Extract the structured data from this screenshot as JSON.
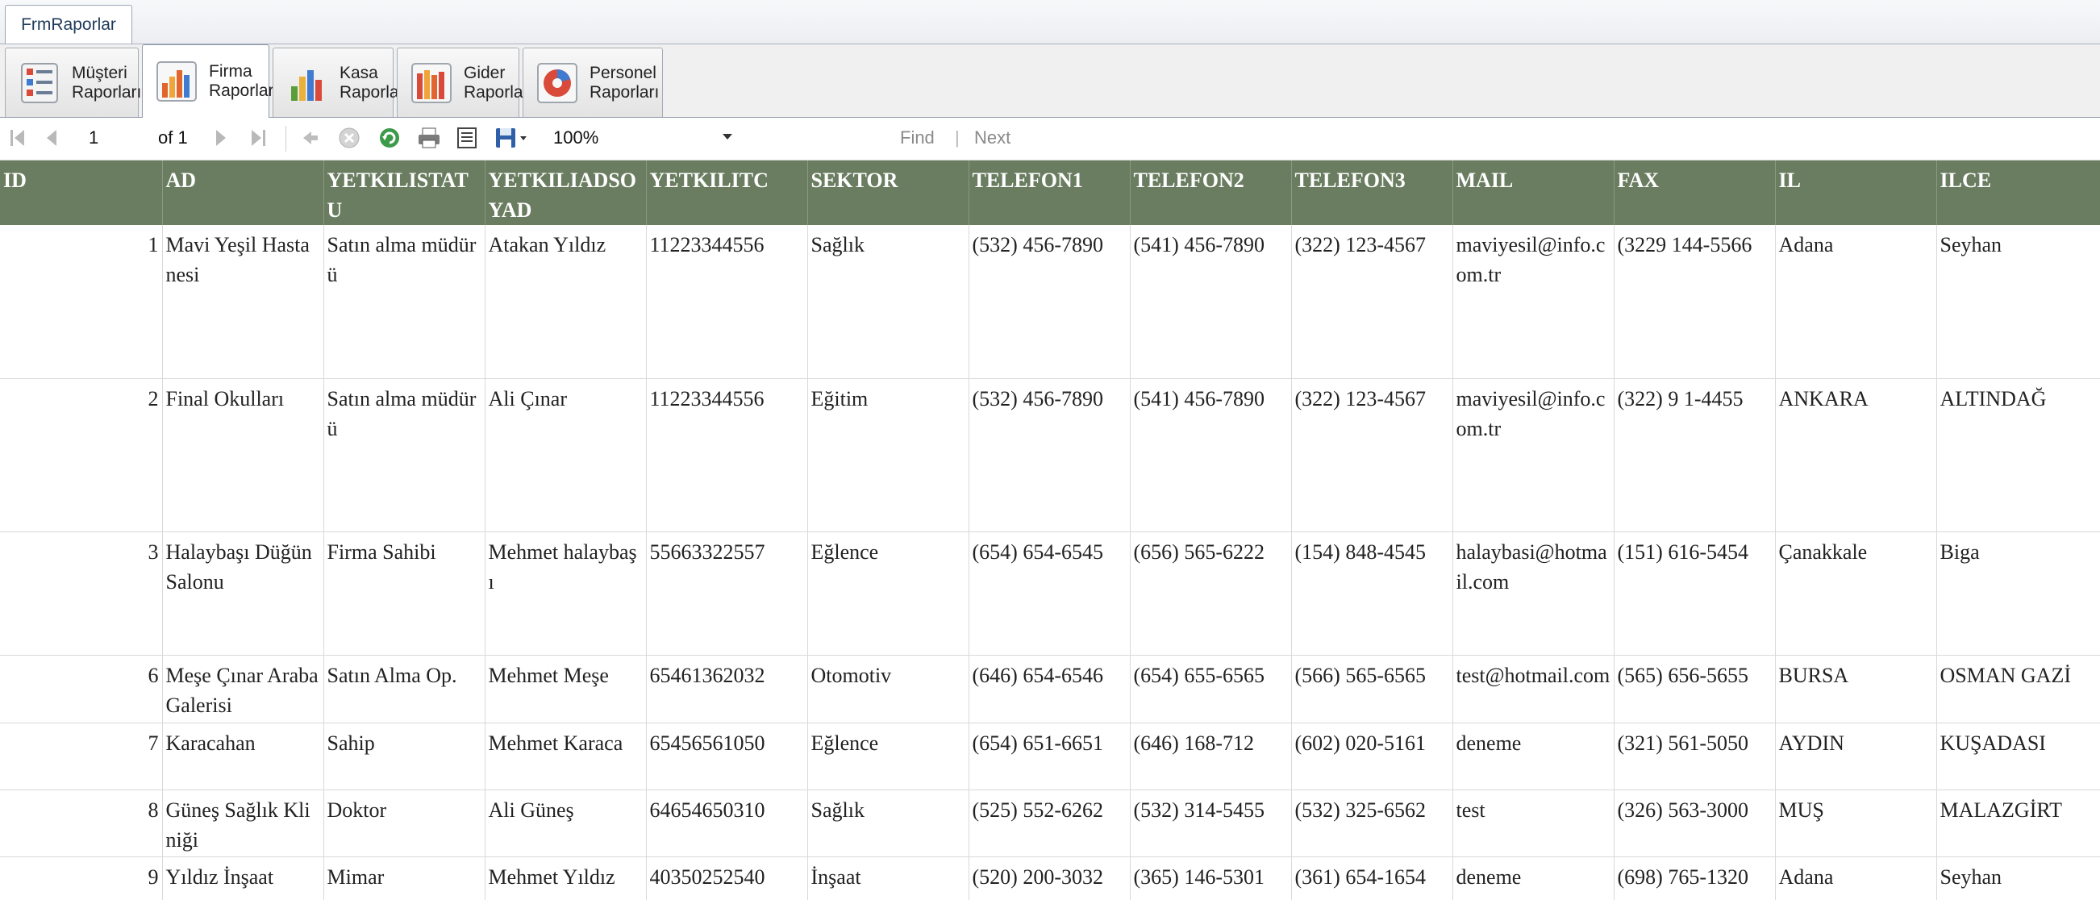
{
  "window": {
    "tab_title": "FrmRaporlar"
  },
  "report_tabs": [
    {
      "label": "Müşteri Raporları",
      "icon": "customer-report-icon"
    },
    {
      "label": "Firma Raporları",
      "icon": "bar-chart-icon"
    },
    {
      "label": "Kasa Raporları",
      "icon": "bar-chart-icon"
    },
    {
      "label": "Gider Raporları",
      "icon": "bar-chart-icon"
    },
    {
      "label": "Personel Raporları",
      "icon": "pie-chart-icon"
    }
  ],
  "active_tab": 1,
  "toolbar": {
    "page_value": "1",
    "of_label": "of 1",
    "zoom": "100%",
    "find_label": "Find",
    "separator": "|",
    "next_label": "Next"
  },
  "colors": {
    "header_bg": "#6a7d60",
    "header_text": "#ffffff"
  },
  "table": {
    "columns": [
      "ID",
      "AD",
      "YETKILISTATU",
      "YETKILIADSOYAD",
      "YETKILITC",
      "SEKTOR",
      "TELEFON1",
      "TELEFON2",
      "TELEFON3",
      "MAIL",
      "FAX",
      "IL",
      "ILCE"
    ],
    "rows": [
      [
        "1",
        "Mavi Yeşil Hastanesi",
        "Satın alma müdürü",
        "Atakan Yıldız",
        "11223344556",
        "Sağlık",
        "(532) 456-7890",
        "(541) 456-7890",
        "(322) 123-4567",
        "maviyesil@info.com.tr",
        "(3229 144-5566",
        "Adana",
        "Seyhan"
      ],
      [
        "2",
        "Final Okulları",
        "Satın alma müdürü",
        "Ali Çınar",
        "11223344556",
        "Eğitim",
        "(532) 456-7890",
        "(541) 456-7890",
        "(322) 123-4567",
        "maviyesil@info.com.tr",
        "(322) 9 1-4455",
        "ANKARA",
        "ALTINDAĞ"
      ],
      [
        "3",
        "Halaybaşı Düğün Salonu",
        "Firma Sahibi",
        "Mehmet halaybaşı",
        "55663322557",
        "Eğlence",
        "(654) 654-6545",
        "(656) 565-6222",
        "(154) 848-4545",
        "halaybasi@hotmail.com",
        "(151) 616-5454",
        "Çanakkale",
        "Biga"
      ],
      [
        "6",
        "Meşe Çınar Araba Galerisi",
        "Satın Alma Op.",
        "Mehmet Meşe",
        "65461362032",
        "Otomotiv",
        "(646) 654-6546",
        "(654) 655-6565",
        "(566) 565-6565",
        "test@hotmail.com",
        "(565) 656-5655",
        "BURSA",
        "OSMAN GAZİ"
      ],
      [
        "7",
        "Karacahan",
        "Sahip",
        "Mehmet Karaca",
        "65456561050",
        "Eğlence",
        "(654) 651-6651",
        "(646) 168-712",
        "(602) 020-5161",
        "deneme",
        "(321) 561-5050",
        "AYDIN",
        "KUŞADASI"
      ],
      [
        "8",
        "Güneş Sağlık Kliniği",
        "Doktor",
        "Ali Güneş",
        "64654650310",
        "Sağlık",
        "(525) 552-6262",
        "(532) 314-5455",
        "(532) 325-6562",
        "test",
        "(326) 563-3000",
        "MUŞ",
        "MALAZGİRT"
      ],
      [
        "9",
        "Yıldız İnşaat",
        "Mimar",
        "Mehmet Yıldız",
        "40350252540",
        "İnşaat",
        "(520) 200-3032",
        "(365) 146-5301",
        "(361) 654-1654",
        "deneme",
        "(698) 765-1320",
        "Adana",
        "Seyhan"
      ]
    ]
  }
}
